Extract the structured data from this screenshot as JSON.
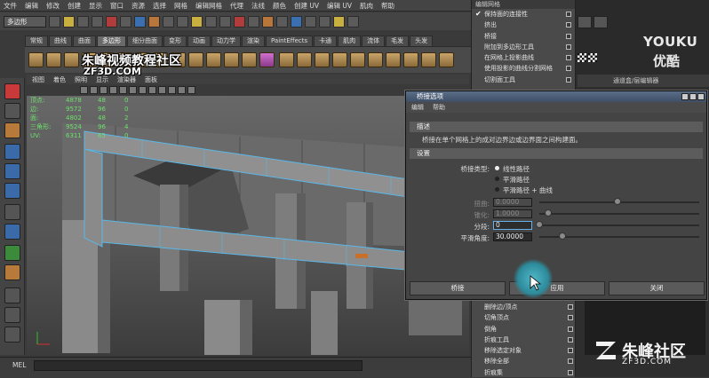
{
  "menubar": [
    "文件",
    "编辑",
    "修改",
    "创建",
    "显示",
    "窗口",
    "资源",
    "选择",
    "网格",
    "编辑网格",
    "代理",
    "法线",
    "颜色",
    "创建 UV",
    "编辑 UV",
    "肌肉",
    "帮助"
  ],
  "statusline": {
    "mode": "多边形"
  },
  "shelf_tabs": [
    "常规",
    "曲线",
    "曲面",
    "多边形",
    "细分曲面",
    "变形",
    "动画",
    "动力学",
    "渲染",
    "PaintEffects",
    "卡通",
    "肌肉",
    "流体",
    "毛发",
    "头发"
  ],
  "shelf_active": "多边形",
  "viewport_menu": [
    "视图",
    "着色",
    "照明",
    "显示",
    "渲染器",
    "面板"
  ],
  "hud": {
    "rows": [
      {
        "label": "顶点:",
        "a": "4878",
        "b": "48",
        "c": "0"
      },
      {
        "label": "边:",
        "a": "9572",
        "b": "96",
        "c": "0"
      },
      {
        "label": "面:",
        "a": "4802",
        "b": "48",
        "c": "2"
      },
      {
        "label": "三角形:",
        "a": "9524",
        "b": "96",
        "c": "4"
      },
      {
        "label": "UV:",
        "a": "6311",
        "b": "65",
        "c": "0"
      }
    ]
  },
  "popup_menu": {
    "title": "编辑网格",
    "items": [
      {
        "label": "保持面的连接性",
        "checked": true
      },
      {
        "label": "挤出"
      },
      {
        "label": "桥接"
      },
      {
        "label": "附加到多边形工具"
      },
      {
        "label": "在网格上投影曲线"
      },
      {
        "label": "使用投影的曲线分割网格"
      },
      {
        "label": "切割面工具"
      }
    ],
    "items_bottom": [
      {
        "label": "删除边/顶点"
      },
      {
        "label": "切角顶点"
      },
      {
        "label": "倒角"
      },
      {
        "label": "折痕工具"
      },
      {
        "label": "移除选定对象"
      },
      {
        "label": "移除全部"
      },
      {
        "label": "折痕集"
      }
    ]
  },
  "dialog": {
    "title": "桥接选项",
    "menu": [
      "编辑",
      "帮助"
    ],
    "desc_section": "描述",
    "desc_text": "桥接在单个网格上的成对边界边或边界面之间构建面。",
    "settings_section": "设置",
    "bridge_type_label": "桥接类型:",
    "bridge_types": [
      "线性路径",
      "平滑路径",
      "平滑路径 + 曲线"
    ],
    "bridge_type_selected": 0,
    "twist_label": "扭曲:",
    "twist_value": "0.0000",
    "taper_label": "锥化:",
    "taper_value": "1.0000",
    "divisions_label": "分段:",
    "divisions_value": "0",
    "smoothing_label": "平滑角度:",
    "smoothing_value": "30.0000",
    "buttons": {
      "bridge": "桥接",
      "apply": "应用",
      "close": "关闭"
    }
  },
  "right_panel": {
    "brand": "YOUKU",
    "brand_cn": "优酷",
    "layer_label": "通道盒/层编辑器"
  },
  "cmdline": {
    "label": "MEL"
  },
  "watermark": {
    "line1": "朱峰视频教程社区",
    "line2": "ZF3D.COM",
    "logo": "朱峰社区",
    "logo_url": "ZF3D.COM"
  }
}
